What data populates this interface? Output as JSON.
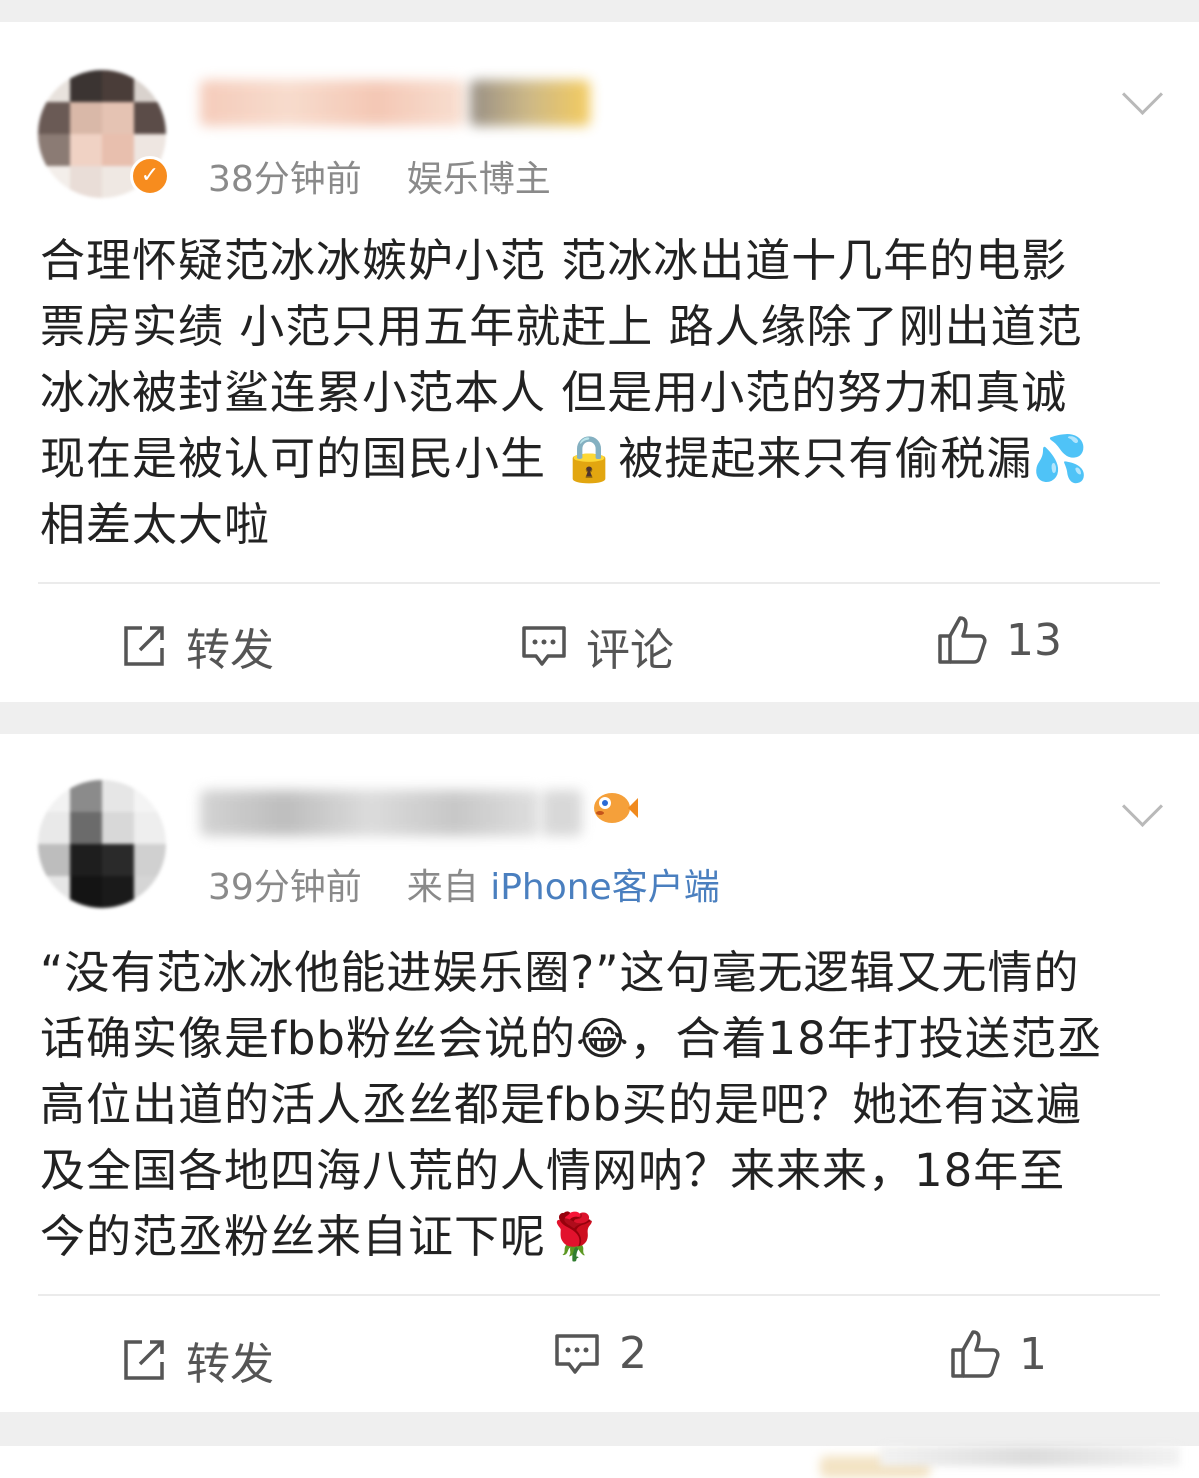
{
  "posts": [
    {
      "time": "38分钟前",
      "tag": "娱乐博主",
      "source_prefix": "",
      "source": "",
      "text_lines": [
        "合理怀疑范冰冰嫉妒小范 范冰冰出道十几年的电影",
        "票房实绩 小范只用五年就赶上 路人缘除了刚出道范",
        "冰冰被封鲨连累小范本人 但是用小范的努力和真诚",
        "现在是被认可的国民小生 🔒被提起来只有偷税漏💦",
        "相差太大啦"
      ],
      "actions": {
        "repost": "转发",
        "comment": "评论",
        "like": "13"
      }
    },
    {
      "time": "39分钟前",
      "tag": "",
      "source_prefix": "来自",
      "source": "iPhone客户端",
      "text_lines": [
        "“没有范冰冰他能进娱乐圈?”这句毫无逻辑又无情的",
        "话确实像是fbb粉丝会说的😂，合着18年打投送范丞",
        "高位出道的活人丞丝都是fbb买的是吧？她还有这遍",
        "及全国各地四海八荒的人情网呐？来来来，18年至",
        "今的范丞粉丝来自证下呢🌹"
      ],
      "actions": {
        "repost": "转发",
        "comment": "2",
        "like": "1"
      }
    }
  ],
  "icons": {
    "repost": "repost-icon",
    "comment": "comment-icon",
    "like": "thumbs-up-icon",
    "more": "chevron-down-icon",
    "verified": "verified-badge-icon"
  },
  "colors": {
    "background": "#efefef",
    "card": "#ffffff",
    "meta_text": "#8a8a8a",
    "source_link": "#4a7fbf",
    "verified": "#f78c1e"
  }
}
